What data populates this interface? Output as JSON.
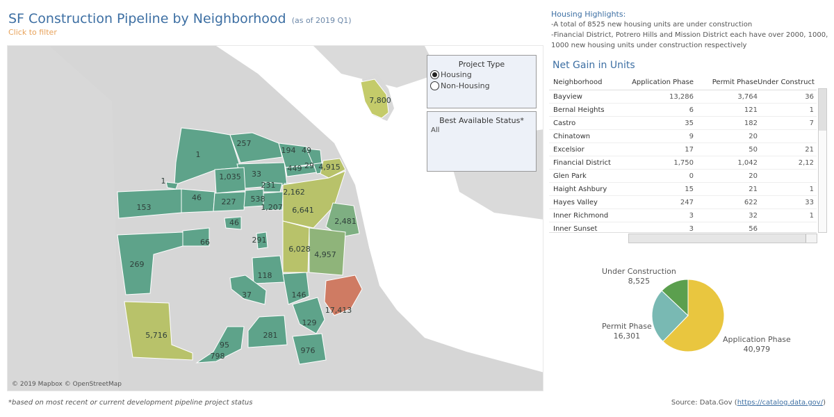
{
  "header": {
    "title": "SF Construction Pipeline by Neighborhood",
    "subtitle": "(as of 2019 Q1)",
    "filter_hint": "Click to filter"
  },
  "map": {
    "credits": "© 2019 Mapbox © OpenStreetMap",
    "labels": [
      "7,800",
      "1",
      "257",
      "194",
      "49",
      "449",
      "29",
      "4,915",
      "33",
      "1,035",
      "1",
      "231",
      "2,162",
      "153",
      "46",
      "227",
      "538",
      "1,207",
      "6,641",
      "2,481",
      "46",
      "66",
      "291",
      "6,028",
      "4,957",
      "269",
      "118",
      "37",
      "146",
      "17,413",
      "129",
      "5,716",
      "95",
      "798",
      "281",
      "976"
    ],
    "colors": {
      "green": "#5ea38a",
      "olive": "#b8c26a",
      "mid": "#8fb47a",
      "red": "#cf7b63",
      "land": "#d3d3d3",
      "water": "#ffffff"
    }
  },
  "project_type": {
    "title": "Project Type",
    "options": [
      "Housing",
      "Non-Housing"
    ],
    "selected": "Housing"
  },
  "status_filter": {
    "title": "Best Available Status*",
    "value": "All"
  },
  "highlights": {
    "title": "Housing Highlights:",
    "line1": "-A total of 8525 new housing units are under construction",
    "line2": "-Financial District, Potrero Hills and Mission District each have over 2000, 1000, 1000 new housing units under construction respectively"
  },
  "table": {
    "title": "Net Gain in Units",
    "columns": [
      "Neighborhood",
      "Application Phase",
      "Permit Phase",
      "Under Construct"
    ],
    "rows": [
      {
        "n": "Bayview",
        "a": "13,286",
        "p": "3,764",
        "u": "36"
      },
      {
        "n": "Bernal Heights",
        "a": "6",
        "p": "121",
        "u": "1"
      },
      {
        "n": "Castro",
        "a": "35",
        "p": "182",
        "u": "7"
      },
      {
        "n": "Chinatown",
        "a": "9",
        "p": "20",
        "u": ""
      },
      {
        "n": "Excelsior",
        "a": "17",
        "p": "50",
        "u": "21"
      },
      {
        "n": "Financial District",
        "a": "1,750",
        "p": "1,042",
        "u": "2,12"
      },
      {
        "n": "Glen Park",
        "a": "0",
        "p": "20",
        "u": ""
      },
      {
        "n": "Haight Ashbury",
        "a": "15",
        "p": "21",
        "u": "1"
      },
      {
        "n": "Hayes Valley",
        "a": "247",
        "p": "622",
        "u": "33"
      },
      {
        "n": "Inner Richmond",
        "a": "3",
        "p": "32",
        "u": "1"
      },
      {
        "n": "Inner Sunset",
        "a": "3",
        "p": "56",
        "u": ""
      }
    ]
  },
  "pie": {
    "slices": [
      {
        "name": "Application Phase",
        "value": 40979,
        "value_label": "40,979",
        "color": "#e9c63f"
      },
      {
        "name": "Permit Phase",
        "value": 16301,
        "value_label": "16,301",
        "color": "#79b9b3"
      },
      {
        "name": "Under Construction",
        "value": 8525,
        "value_label": "8,525",
        "color": "#5b9f4e"
      }
    ]
  },
  "footer": {
    "note": "*based on most recent or current development pipeline project status",
    "source_prefix": "Source:  Data.Gov (",
    "source_link": "https://catalog.data.gov/",
    "source_suffix": ")"
  }
}
